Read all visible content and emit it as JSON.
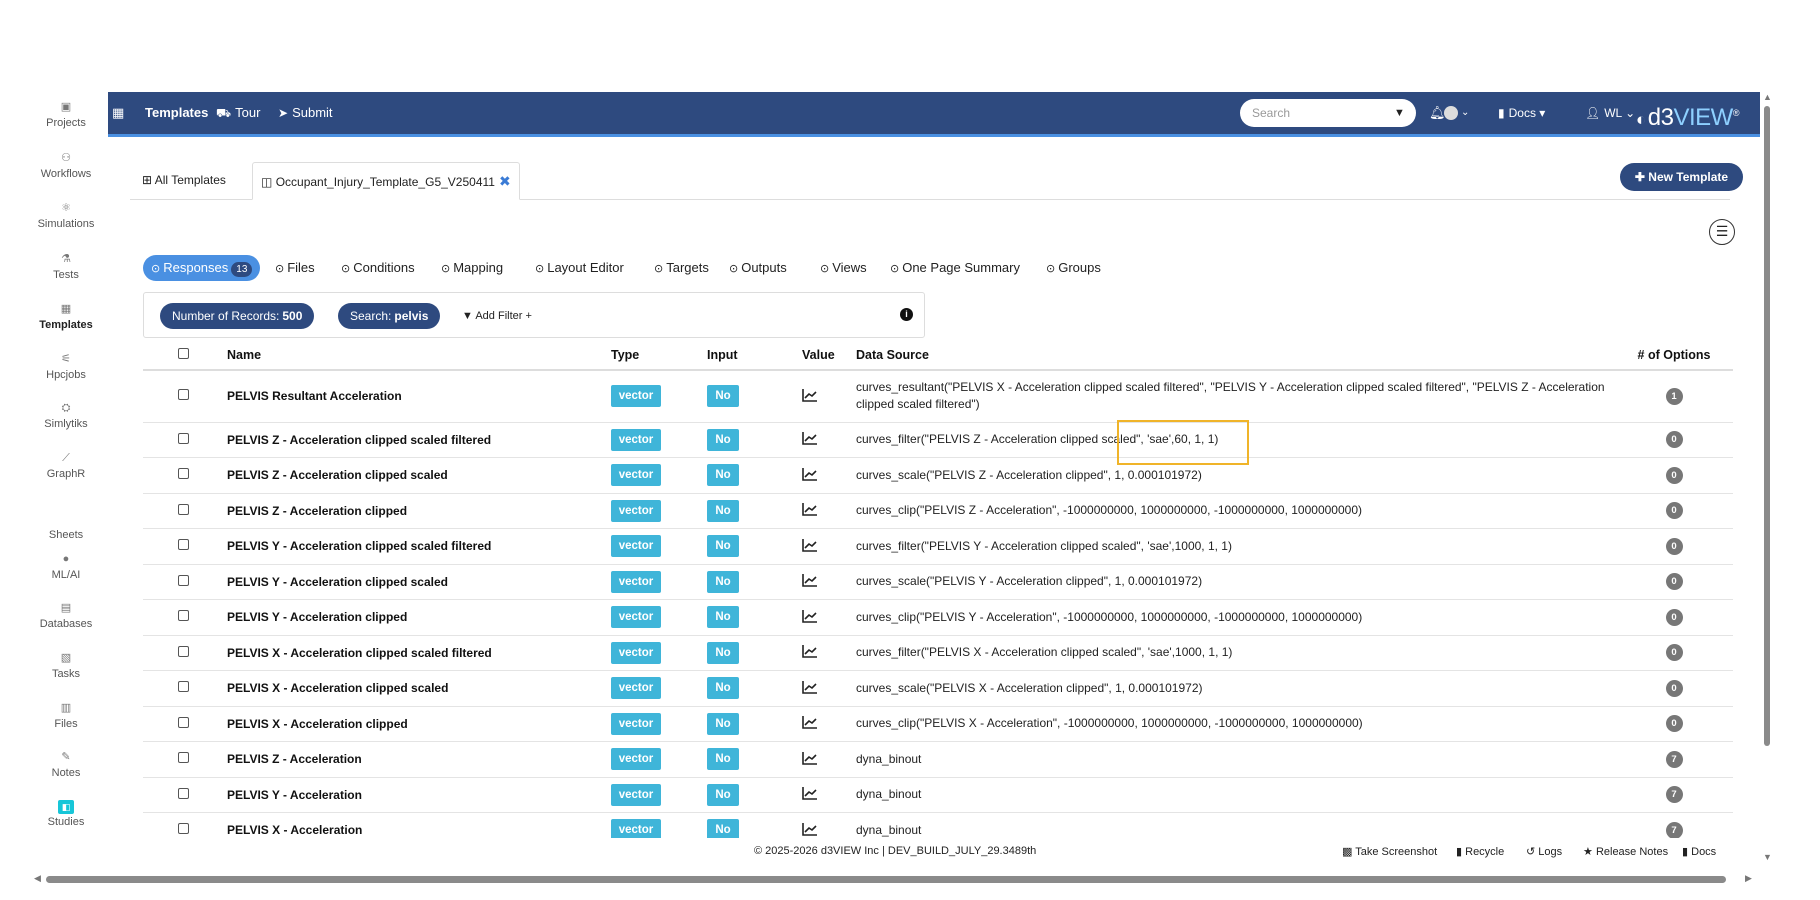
{
  "sidebar": {
    "items": [
      {
        "label": "Projects",
        "icon": "projects-icon",
        "glyph": "▣"
      },
      {
        "label": "Workflows",
        "icon": "workflows-icon",
        "glyph": "⚇"
      },
      {
        "label": "Simulations",
        "icon": "simulations-icon",
        "glyph": "⚛"
      },
      {
        "label": "Tests",
        "icon": "tests-icon",
        "glyph": "⚗"
      },
      {
        "label": "Templates",
        "icon": "templates-icon",
        "glyph": "▦"
      },
      {
        "label": "Hpcjobs",
        "icon": "hpcjobs-icon",
        "glyph": "⚟"
      },
      {
        "label": "Simlytiks",
        "icon": "simlytiks-icon",
        "glyph": "⛭"
      },
      {
        "label": "GraphR",
        "icon": "graphr-icon",
        "glyph": "⟋"
      },
      {
        "label": "Sheets",
        "icon": "sheets-icon",
        "glyph": ""
      },
      {
        "label": "ML/AI",
        "icon": "mlai-icon",
        "glyph": "●"
      },
      {
        "label": "Databases",
        "icon": "databases-icon",
        "glyph": "▤"
      },
      {
        "label": "Tasks",
        "icon": "tasks-icon",
        "glyph": "▧"
      },
      {
        "label": "Files",
        "icon": "files-icon",
        "glyph": "▥"
      },
      {
        "label": "Notes",
        "icon": "notes-icon",
        "glyph": "✎"
      },
      {
        "label": "Studies",
        "icon": "studies-icon",
        "glyph": "◧"
      }
    ]
  },
  "navbar": {
    "templates": "Templates",
    "tour": "Tour",
    "submit": "Submit",
    "search_placeholder": "Search",
    "docs": "Docs",
    "user": "WL",
    "brand_prefix": "d3",
    "brand_suffix": "VIEW",
    "brand_mark": "®"
  },
  "tabs": {
    "all": "All Templates",
    "active": "Occupant_Injury_Template_G5_V250411"
  },
  "new_template": "New Template",
  "subtabs": {
    "responses": "Responses",
    "responses_count": "13",
    "items": [
      "Files",
      "Conditions",
      "Mapping",
      "Layout Editor",
      "Targets",
      "Outputs",
      "Views",
      "One Page Summary",
      "Groups"
    ]
  },
  "filters": {
    "records_label": "Number of Records:",
    "records_value": "500",
    "search_label": "Search:",
    "search_value": "pelvis",
    "add_filter": "Add Filter"
  },
  "table": {
    "headers": {
      "name": "Name",
      "type": "Type",
      "input": "Input",
      "value": "Value",
      "source": "Data Source",
      "options": "# of Options"
    },
    "rows": [
      {
        "name": "PELVIS Resultant Acceleration",
        "type": "vector",
        "input": "No",
        "source": "curves_resultant(\"PELVIS X - Acceleration clipped scaled filtered\", \"PELVIS Y - Acceleration clipped scaled filtered\", \"PELVIS Z - Acceleration clipped scaled filtered\")",
        "options": "1"
      },
      {
        "name": "PELVIS Z - Acceleration clipped scaled filtered",
        "type": "vector",
        "input": "No",
        "source": "curves_filter(\"PELVIS Z - Acceleration clipped scaled\", 'sae',60, 1, 1)",
        "options": "0"
      },
      {
        "name": "PELVIS Z - Acceleration clipped scaled",
        "type": "vector",
        "input": "No",
        "source": "curves_scale(\"PELVIS Z - Acceleration clipped\", 1, 0.000101972)",
        "options": "0"
      },
      {
        "name": "PELVIS Z - Acceleration clipped",
        "type": "vector",
        "input": "No",
        "source": "curves_clip(\"PELVIS Z - Acceleration\", -1000000000, 1000000000, -1000000000, 1000000000)",
        "options": "0"
      },
      {
        "name": "PELVIS Y - Acceleration clipped scaled filtered",
        "type": "vector",
        "input": "No",
        "source": "curves_filter(\"PELVIS Y - Acceleration clipped scaled\", 'sae',1000, 1, 1)",
        "options": "0"
      },
      {
        "name": "PELVIS Y - Acceleration clipped scaled",
        "type": "vector",
        "input": "No",
        "source": "curves_scale(\"PELVIS Y - Acceleration clipped\", 1, 0.000101972)",
        "options": "0"
      },
      {
        "name": "PELVIS Y - Acceleration clipped",
        "type": "vector",
        "input": "No",
        "source": "curves_clip(\"PELVIS Y - Acceleration\", -1000000000, 1000000000, -1000000000, 1000000000)",
        "options": "0"
      },
      {
        "name": "PELVIS X - Acceleration clipped scaled filtered",
        "type": "vector",
        "input": "No",
        "source": "curves_filter(\"PELVIS X - Acceleration clipped scaled\", 'sae',1000, 1, 1)",
        "options": "0"
      },
      {
        "name": "PELVIS X - Acceleration clipped scaled",
        "type": "vector",
        "input": "No",
        "source": "curves_scale(\"PELVIS X - Acceleration clipped\", 1, 0.000101972)",
        "options": "0"
      },
      {
        "name": "PELVIS X - Acceleration clipped",
        "type": "vector",
        "input": "No",
        "source": "curves_clip(\"PELVIS X - Acceleration\", -1000000000, 1000000000, -1000000000, 1000000000)",
        "options": "0"
      },
      {
        "name": "PELVIS Z - Acceleration",
        "type": "vector",
        "input": "No",
        "source": "dyna_binout",
        "options": "7"
      },
      {
        "name": "PELVIS Y - Acceleration",
        "type": "vector",
        "input": "No",
        "source": "dyna_binout",
        "options": "7"
      },
      {
        "name": "PELVIS X - Acceleration",
        "type": "vector",
        "input": "No",
        "source": "dyna_binout",
        "options": "7"
      }
    ]
  },
  "footer": {
    "copyright": "© 2025-2026 d3VIEW Inc | DEV_BUILD_JULY_29.3489th",
    "screenshot": "Take Screenshot",
    "recycle": "Recycle",
    "logs": "Logs",
    "release_notes": "Release Notes",
    "docs": "Docs"
  },
  "colors": {
    "navbar": "#2e4a7f",
    "accent": "#4a90e2",
    "badge": "#3fb5d9",
    "highlight": "#f0b429"
  }
}
